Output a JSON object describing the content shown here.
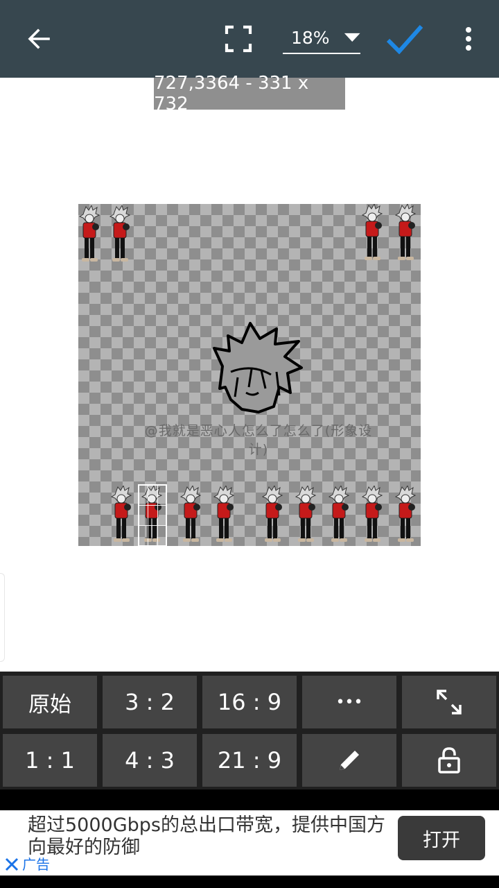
{
  "toolbar_top": {
    "back_icon": "arrow-left-icon",
    "fullscreen_icon": "fullscreen-icon",
    "zoom": "18%",
    "confirm_icon": "checkmark-icon",
    "more_icon": "more-vertical-icon"
  },
  "selection_info": "727,3364 - 331 x 732",
  "canvas": {
    "watermark": "@我就是恶心人怎么了怎么了(形象设计)"
  },
  "ratio_buttons": {
    "original": "原始",
    "r3_2": "3 : 2",
    "r16_9": "16 : 9",
    "more": "•••",
    "r1_1": "1 : 1",
    "r4_3": "4 : 3",
    "r21_9": "21 : 9",
    "expand_icon": "expand-arrows-icon",
    "edit_icon": "pencil-icon",
    "lock_icon": "unlock-icon"
  },
  "ad": {
    "text": "超过5000Gbps的总出口带宽，提供中国方向最好的防御",
    "open_label": "打开",
    "ad_label": "广告",
    "close_icon": "close-icon"
  },
  "colors": {
    "toolbar": "#37474f",
    "accent": "#1e88e5",
    "button_bg": "#444444"
  }
}
